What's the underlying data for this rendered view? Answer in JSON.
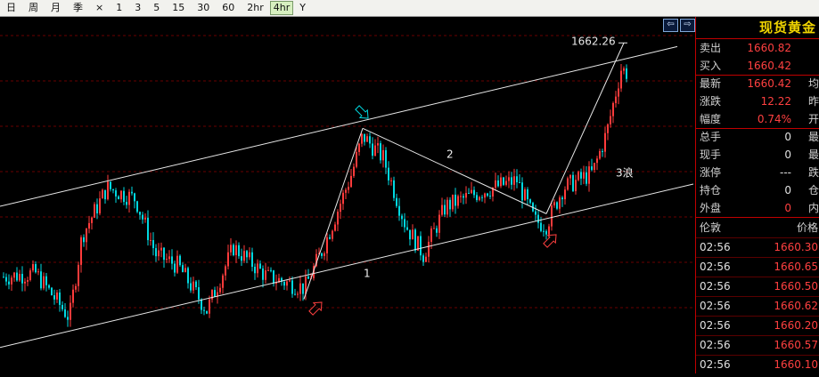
{
  "toolbar": {
    "items": [
      "日",
      "周",
      "月",
      "季",
      "×",
      "1",
      "3",
      "5",
      "15",
      "30",
      "60",
      "2hr",
      "4hr",
      "Y"
    ],
    "active": "4hr"
  },
  "nav": {
    "left": "⇦",
    "right": "⇨"
  },
  "chart_data": {
    "type": "candlestick",
    "timeframe": "4hr",
    "y_range": [
      1620,
      1668
    ],
    "peak_label": "1662.26",
    "annotations": [
      "1",
      "2",
      "3浪"
    ],
    "candles": [],
    "channel": {
      "upper": [
        [
          0,
          1642.5
        ],
        [
          760,
          1664.0
        ]
      ],
      "lower": [
        [
          0,
          1623.5
        ],
        [
          778,
          1645.5
        ]
      ]
    },
    "wave_lines": [
      [
        [
          341,
          1630.0
        ],
        [
          407,
          1653.0
        ]
      ],
      [
        [
          407,
          1653.0
        ],
        [
          613,
          1641.5
        ]
      ],
      [
        [
          613,
          1641.5
        ],
        [
          700,
          1664.5
        ]
      ]
    ],
    "colors": {
      "up": "#ff3b3b",
      "down": "#00d8e0",
      "grid": "#6a0000",
      "line": "#e8e8e8"
    }
  },
  "panel": {
    "title": "现货黄金",
    "quotes": [
      {
        "label": "卖出",
        "value": "1660.82",
        "color": "#ff4040",
        "extra": ""
      },
      {
        "label": "买入",
        "value": "1660.42",
        "color": "#ff4040",
        "extra": ""
      },
      {
        "label": "最新",
        "value": "1660.42",
        "color": "#ff4040",
        "extra": "均"
      },
      {
        "label": "涨跌",
        "value": "12.22",
        "color": "#ff4040",
        "extra": "昨"
      },
      {
        "label": "幅度",
        "value": "0.74%",
        "color": "#ff4040",
        "extra": "开"
      },
      {
        "label": "总手",
        "value": "0",
        "color": "#e0e0e0",
        "extra": "最"
      },
      {
        "label": "现手",
        "value": "0",
        "color": "#e0e0e0",
        "extra": "最"
      },
      {
        "label": "涨停",
        "value": "---",
        "color": "#e0e0e0",
        "extra": "跌"
      },
      {
        "label": "持仓",
        "value": "0",
        "color": "#e0e0e0",
        "extra": "仓"
      },
      {
        "label": "外盘",
        "value": "0",
        "color": "#ff4040",
        "extra": "内"
      }
    ],
    "ticks_header": {
      "time": "伦敦",
      "price": "价格"
    },
    "ticks": [
      {
        "time": "02:56",
        "price": "1660.30"
      },
      {
        "time": "02:56",
        "price": "1660.65"
      },
      {
        "time": "02:56",
        "price": "1660.50"
      },
      {
        "time": "02:56",
        "price": "1660.62"
      },
      {
        "time": "02:56",
        "price": "1660.20"
      },
      {
        "time": "02:56",
        "price": "1660.57"
      },
      {
        "time": "02:56",
        "price": "1660.10"
      }
    ]
  }
}
